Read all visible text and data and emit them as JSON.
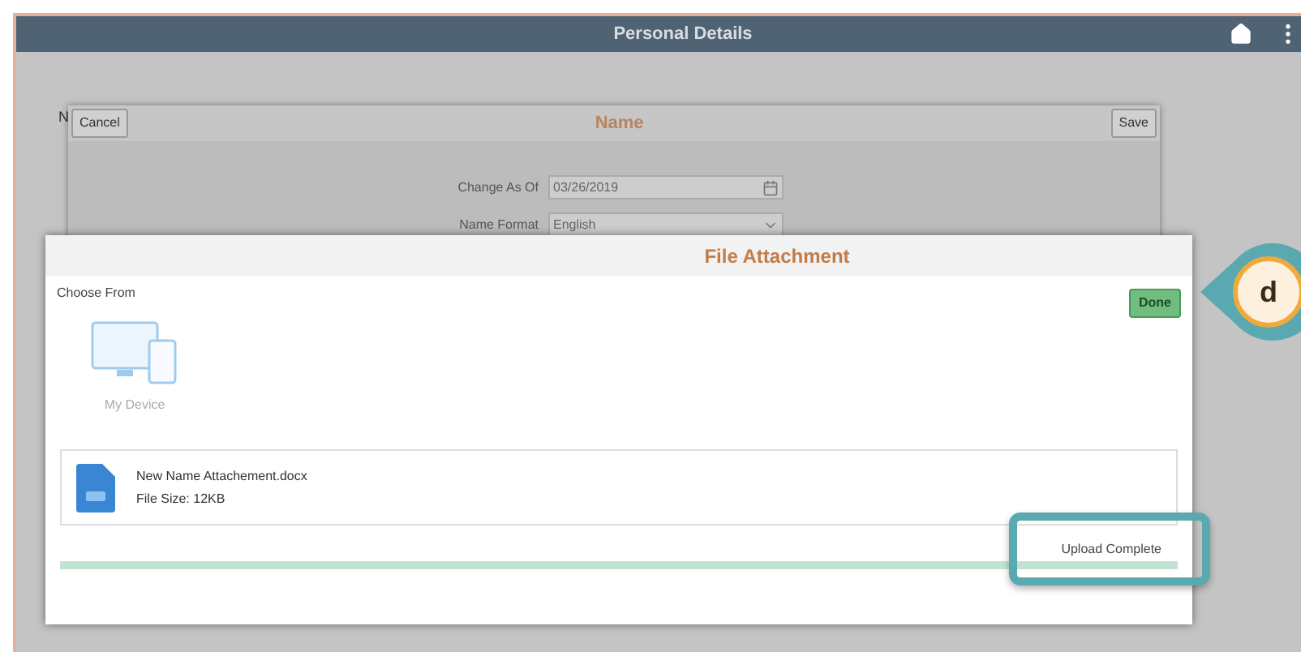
{
  "window": {
    "title": "Personal Details"
  },
  "background_label": "N",
  "name_dialog": {
    "title": "Name",
    "cancel_button": "Cancel",
    "save_button": "Save",
    "fields": [
      {
        "label": "Change As Of",
        "value": "03/26/2019",
        "kind": "date"
      },
      {
        "label": "Name Format",
        "value": "English",
        "kind": "select"
      }
    ]
  },
  "file_dialog": {
    "title": "File Attachment",
    "done_button": "Done",
    "section_label": "Choose From",
    "source": "My Device",
    "file": {
      "name": "New Name Attachement.docx",
      "size": "File Size: 12KB"
    },
    "upload": {
      "level": 1,
      "status": "Upload Complete"
    }
  },
  "callout": {
    "label": "d"
  }
}
